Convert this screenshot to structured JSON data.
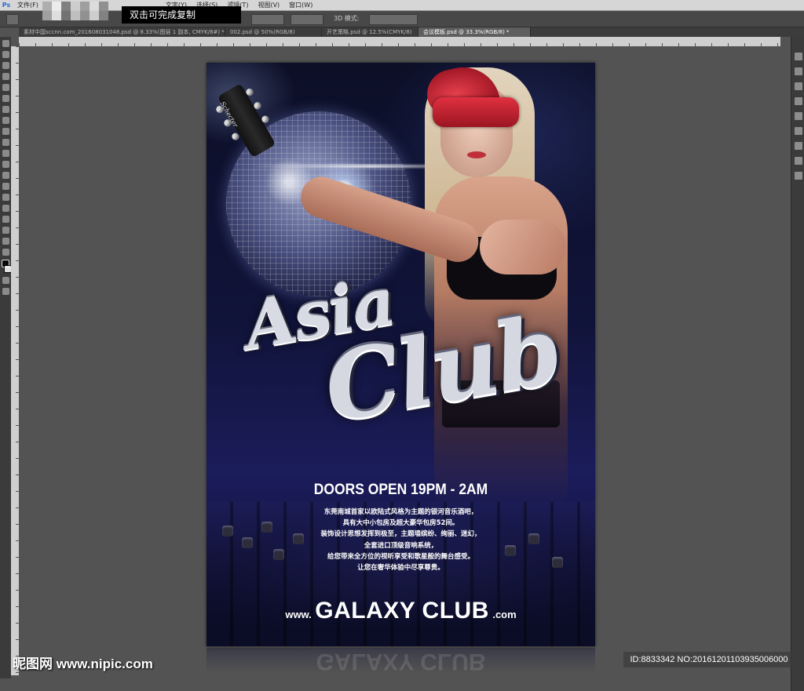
{
  "app": {
    "logo": "Ps",
    "menu": [
      "文件(F)",
      "文字(Y)",
      "选择(S)",
      "滤镜(T)",
      "视图(V)",
      "窗口(W)"
    ],
    "tooltip": "双击可完成复制",
    "options_label": "3D 模式:"
  },
  "tabs": [
    {
      "label": "素材中国sccnn.com_201608031048.psd @ 8.33%(图层 1 副本, CMYK/8#) *",
      "active": false
    },
    {
      "label": "002.psd @ 50%(RGB/8)",
      "active": false
    },
    {
      "label": "开艺策略.psd @ 12.5%(CMYK/8)",
      "active": false
    },
    {
      "label": "会议模板.psd @ 33.3%(RGB/8) *",
      "active": true
    }
  ],
  "poster": {
    "guitar_brand": "Schecter",
    "logo_line1": "Asia",
    "logo_line2": "Club",
    "doors": "DOORS OPEN 19PM - 2AM",
    "description": [
      "东莞南城首家以欧陆式风格为主题的银河音乐酒吧，",
      "具有大中小包房及超大豪华包房52间。",
      "装饰设计思想发挥到极至，主题墙缤纷、绚丽、迷幻，",
      "全套进口顶级音响系统，",
      "给您带来全方位的视听享受和歌星般的舞台感受。",
      "让您在奢华体验中尽享尊贵。"
    ],
    "website_prefix": "www.",
    "website_main": "GALAXY CLUB",
    "website_suffix": ".com",
    "reflection_text": "GALAXY CLUB"
  },
  "watermark": {
    "left": "昵图网 www.nipic.com",
    "right": "ID:8833342 NO:20161201103935006000"
  },
  "colors": {
    "workspace": "#535353",
    "mask_red": "#d42a3a",
    "poster_bg": "#11143a"
  }
}
